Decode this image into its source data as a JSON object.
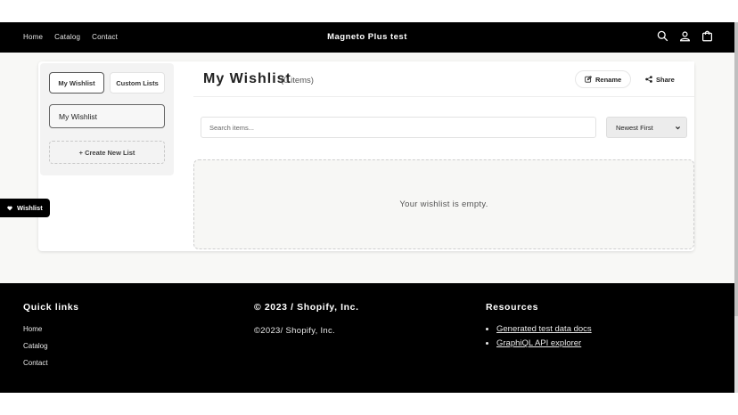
{
  "header": {
    "nav": [
      "Home",
      "Catalog",
      "Contact"
    ],
    "brand": "Magneto Plus test",
    "icons": [
      "search-icon",
      "account-icon",
      "cart-icon"
    ]
  },
  "sidebar": {
    "tabs": [
      {
        "label": "My Wishlist",
        "active": true
      },
      {
        "label": "Custom Lists",
        "active": false
      }
    ],
    "lists": [
      "My Wishlist"
    ],
    "create_label": "+ Create New List"
  },
  "wishlist": {
    "title": "My Wishlist",
    "count": "(0 items)",
    "rename_label": "Rename",
    "share_label": "Share",
    "search_placeholder": "Search items...",
    "sort_value": "Newest First",
    "empty_message": "Your wishlist is empty."
  },
  "floating": {
    "label": "Wishlist"
  },
  "footer": {
    "quick_links_title": "Quick links",
    "quick_links": [
      "Home",
      "Catalog",
      "Contact"
    ],
    "copyright_title": "© 2023 / Shopify, Inc.",
    "copyright_text": "©2023/ Shopify, Inc.",
    "resources_title": "Resources",
    "resources": [
      "Generated test data docs",
      "GraphiQL API explorer"
    ]
  },
  "colors": {
    "header_bg": "#000000",
    "footer_bg": "#000000",
    "page_bg": "#f8f8f6"
  }
}
